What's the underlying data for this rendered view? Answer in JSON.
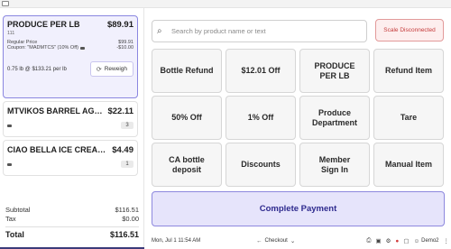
{
  "cart": {
    "items": [
      {
        "name": "PRODUCE PER LB",
        "price": "$89.91",
        "sku": "111",
        "regular_label": "Regular Price",
        "regular_value": "$99.91",
        "coupon_label": "Coupon: \"MADMTCS\" (10% Off)",
        "coupon_value": "-$10.00",
        "weight_text": "0.75 lb @ $133.21 per lb",
        "reweigh_label": "Reweigh",
        "selected": true
      },
      {
        "name": "MTVIKOS BARREL AGED...",
        "price": "$22.11",
        "qty": "3"
      },
      {
        "name": "CIAO BELLA ICE CREAM C...",
        "price": "$4.49",
        "qty": "1"
      }
    ]
  },
  "totals": {
    "subtotal_label": "Subtotal",
    "subtotal": "$116.51",
    "tax_label": "Tax",
    "tax": "$0.00",
    "total_label": "Total",
    "total": "$116.51"
  },
  "search": {
    "placeholder": "Search by product name or text"
  },
  "scale_status": "Scale Disconnected",
  "tiles": [
    "Bottle Refund",
    "$12.01 Off",
    "PRODUCE\nPER LB",
    "Refund Item",
    "50% Off",
    "1% Off",
    "Produce\nDepartment",
    "Tare",
    "CA bottle\ndeposit",
    "Discounts",
    "Member\nSign In",
    "Manual Item"
  ],
  "payment": {
    "label": "Complete Payment"
  },
  "status": {
    "datetime": "Mon, Jul 1  11:54 AM",
    "checkout": "Checkout",
    "user": "Demo2"
  },
  "colors": {
    "accent": "#8d88de",
    "accent_text": "#2e2a8e",
    "scale_error": "#c53a3a"
  }
}
